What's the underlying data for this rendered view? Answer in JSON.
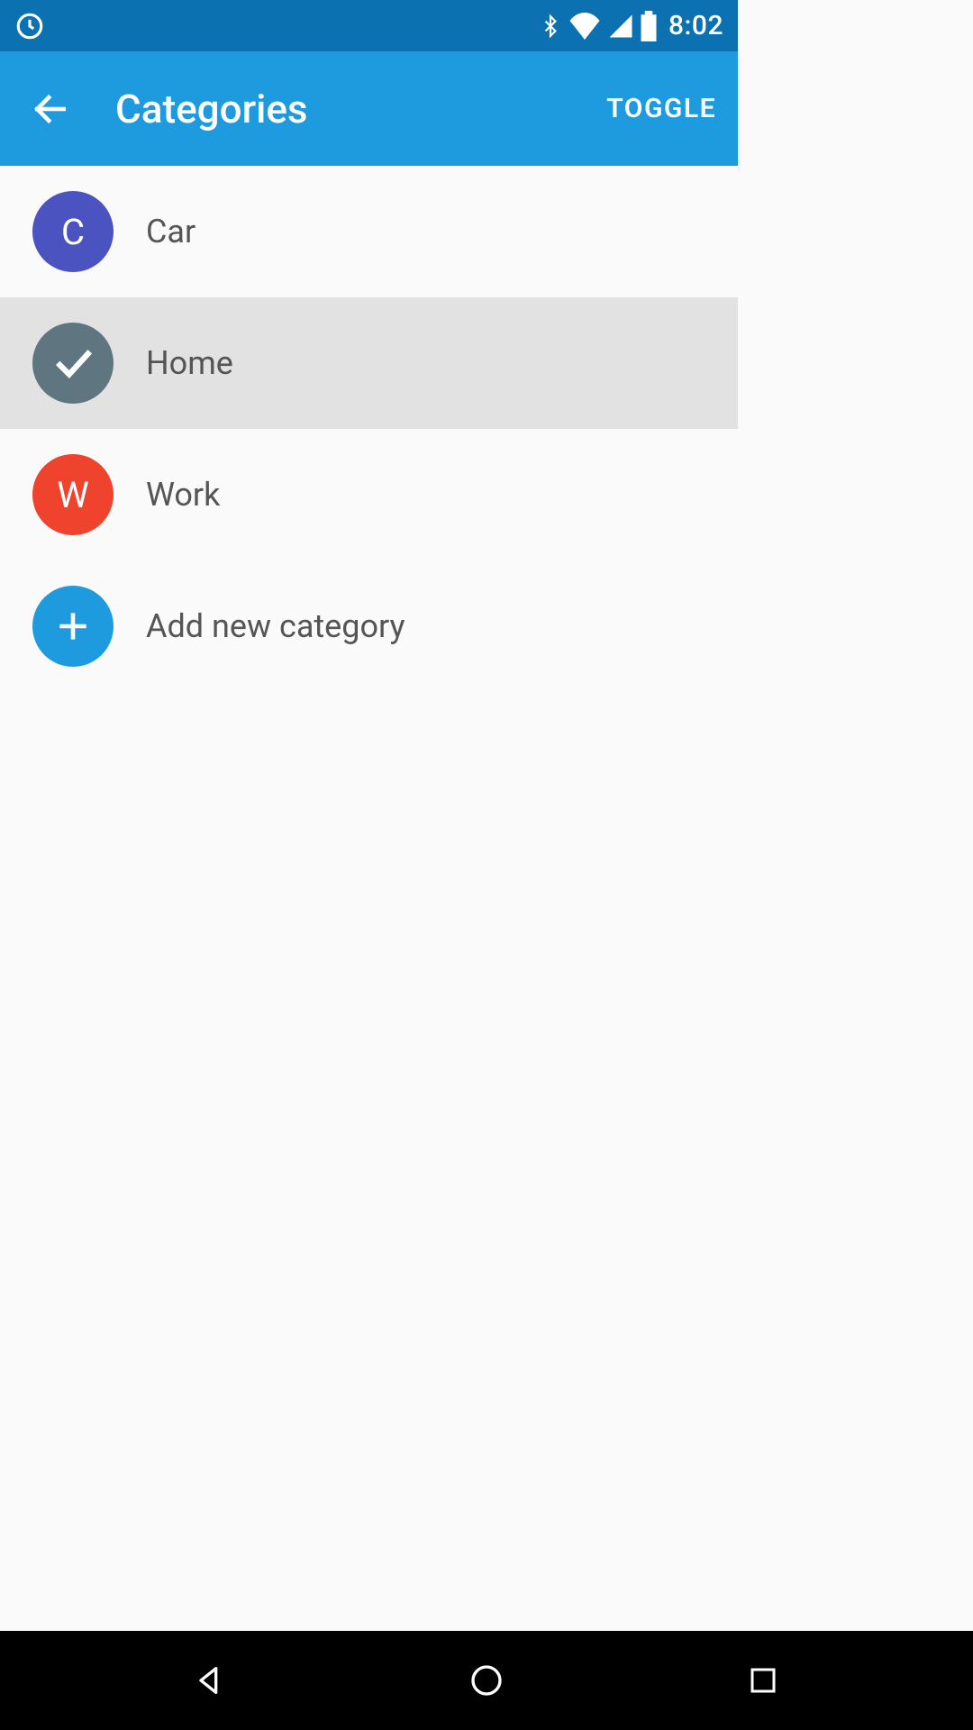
{
  "status_bar": {
    "time": "8:02"
  },
  "app_bar": {
    "title": "Categories",
    "action": "TOGGLE"
  },
  "categories": [
    {
      "letter": "C",
      "label": "Car",
      "color": "#4a53c0",
      "selected": false
    },
    {
      "letter": "",
      "label": "Home",
      "color": "#5f7680",
      "selected": true
    },
    {
      "letter": "W",
      "label": "Work",
      "color": "#f0432d",
      "selected": false
    }
  ],
  "add_item": {
    "label": "Add new category",
    "color": "#1e9bde"
  }
}
